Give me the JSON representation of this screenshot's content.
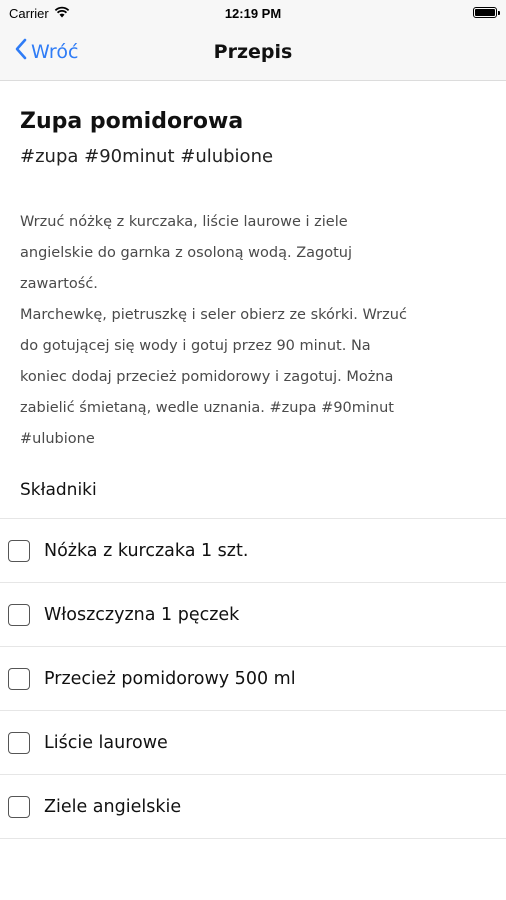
{
  "status": {
    "carrier": "Carrier",
    "time": "12:19 PM",
    "battery_level": 1.0
  },
  "nav": {
    "back_label": "Wróć",
    "title": "Przepis"
  },
  "recipe": {
    "title": "Zupa pomidorowa",
    "tags": "#zupa #90minut #ulubione",
    "description_lines": [
      "Wrzuć nóżkę z kurczaka, liście laurowe i ziele",
      "angielskie do garnka z osoloną wodą. Zagotuj",
      "zawartość.",
      "Marchewkę, pietruszkę i seler obierz ze skórki. Wrzuć",
      "do gotującej się wody i gotuj przez 90 minut. Na",
      "koniec dodaj przecież pomidorowy i zagotuj. Można",
      "zabielić śmietaną, wedle uznania. #zupa #90minut",
      "#ulubione"
    ]
  },
  "ingredients": {
    "header": "Składniki",
    "items": [
      {
        "label": "Nóżka z kurczaka 1 szt.",
        "checked": false
      },
      {
        "label": "Włoszczyzna 1 pęczek",
        "checked": false
      },
      {
        "label": "Przecież pomidorowy 500 ml",
        "checked": false
      },
      {
        "label": "Liście laurowe",
        "checked": false
      },
      {
        "label": "Ziele angielskie",
        "checked": false
      }
    ]
  },
  "colors": {
    "accent": "#2f7cf6",
    "bar_background": "#f7f7f7",
    "body_text": "#4a4a4a"
  },
  "icons": {
    "back": "chevron-left-icon",
    "wifi": "wifi-icon",
    "battery": "battery-icon",
    "checkbox": "checkbox-icon"
  }
}
